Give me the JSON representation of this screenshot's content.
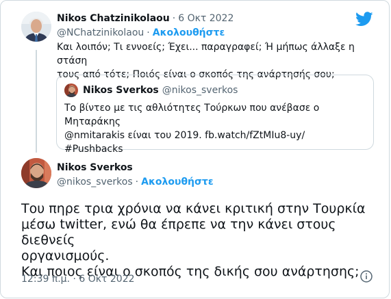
{
  "reply_tweet": {
    "author_name": "Nikos Chatzinikolaou",
    "date": "6 Οκτ 2022",
    "separator": "·",
    "handle": "@NChatzinikolaou",
    "follow_label": "Ακολουθήστε",
    "text_line1": "Και λοιπόν; Τι εννοείς; Έχει... παραγραφεί; Ή μήπως άλλαξε η στάση",
    "text_line2": "τους από τότε; Ποιός είναι ο σκοπός της ανάρτησής σου;"
  },
  "quoted_tweet": {
    "author_name": "Nikos Sverkos",
    "handle": "@nikos_sverkos",
    "text_line1": "Το βίντεο με τις αθλιότητες Τούρκων που ανέβασε ο Μηταράκης",
    "text_line2": "@nmitarakis είναι του 2019. fb.watch/fZtMIu8-uy/",
    "text_line3": "#Pushbacks"
  },
  "main_tweet": {
    "author_name": "Nikos Sverkos",
    "handle": "@nikos_sverkos",
    "follow_label": "Ακολουθήστε",
    "text_line1": "Του πηρε τρια χρόνια να κάνει κριτική στην Τουρκία",
    "text_line2": "μέσω twitter, ενώ θα έπρεπε να την κάνει στους διεθνείς",
    "text_line3": "οργανισμούς.",
    "text_line4": "Και ποιος είναι ο σκοπός της δικής σου ανάρτησης;",
    "timestamp": "12:39 π.μ. · 6 Οκτ 2022"
  },
  "icons": {
    "brand": "twitter-bird-icon",
    "info": "info-icon"
  },
  "colors": {
    "accent": "#1d9bf0",
    "muted_text": "#536471",
    "border": "#cfd9de"
  }
}
